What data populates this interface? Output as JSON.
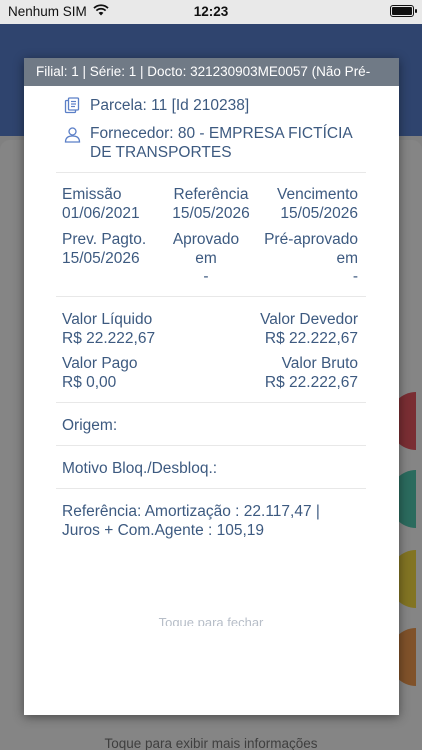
{
  "status_bar": {
    "carrier": "Nenhum SIM",
    "time": "12:23"
  },
  "background": {
    "more_info_hint": "Toque para exibir mais informações"
  },
  "modal": {
    "title": "Filial: 1 | Série: 1 | Docto: 321230903ME0057 (Não Pré-",
    "parcela": "Parcela: 11 [Id 210238]",
    "fornecedor": "Fornecedor: 80 - EMPRESA FICTÍCIA DE TRANSPORTES",
    "emissao_label": "Emissão",
    "emissao_value": "01/06/2021",
    "referencia_label": "Referência",
    "referencia_value": "15/05/2026",
    "vencimento_label": "Vencimento",
    "vencimento_value": "15/05/2026",
    "prev_pagto_label": "Prev. Pagto.",
    "prev_pagto_value": "15/05/2026",
    "aprovado_label_1": "Aprovado",
    "aprovado_label_2": "em",
    "aprovado_value": "-",
    "preaprovado_label_1": "Pré-aprovado",
    "preaprovado_label_2": "em",
    "preaprovado_value": "-",
    "valor_liquido_label": "Valor Líquido",
    "valor_liquido_value": "R$ 22.222,67",
    "valor_devedor_label": "Valor Devedor",
    "valor_devedor_value": "R$ 22.222,67",
    "valor_pago_label": "Valor Pago",
    "valor_pago_value": "R$ 0,00",
    "valor_bruto_label": "Valor Bruto",
    "valor_bruto_value": "R$ 22.222,67",
    "origem_label": "Origem:",
    "motivo_label": "Motivo Bloq./Desbloq.:",
    "referencia_detalhe_1": "Referência: Amortização : 22.117,47 |",
    "referencia_detalhe_2": "Juros + Com.Agente : 105,19",
    "close_hint": "Toque para fechar"
  },
  "colors": {
    "accent_text": "#3d5a80",
    "title_bar": "#707a86",
    "header": "#2f446e"
  }
}
